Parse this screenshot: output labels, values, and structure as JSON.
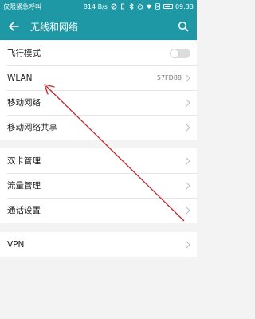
{
  "status_bar": {
    "carrier_text": "仅限紧急呼叫",
    "speed": "814 B/s",
    "time": "09:33"
  },
  "app_bar": {
    "title": "无线和网络"
  },
  "groups": [
    {
      "items": [
        {
          "label": "飞行模式",
          "control": "toggle",
          "toggle_on": false
        },
        {
          "label": "WLAN",
          "value": "57FD88",
          "control": "chevron"
        },
        {
          "label": "移动网络",
          "control": "chevron"
        },
        {
          "label": "移动网络共享",
          "control": "chevron"
        }
      ]
    },
    {
      "items": [
        {
          "label": "双卡管理",
          "control": "chevron"
        },
        {
          "label": "流量管理",
          "control": "chevron"
        },
        {
          "label": "通话设置",
          "control": "chevron"
        }
      ]
    },
    {
      "items": [
        {
          "label": "VPN",
          "control": "chevron"
        }
      ]
    }
  ],
  "colors": {
    "accent": "#1e98a4",
    "annotation_arrow": "#c0282d",
    "background": "#f3f3f3"
  }
}
